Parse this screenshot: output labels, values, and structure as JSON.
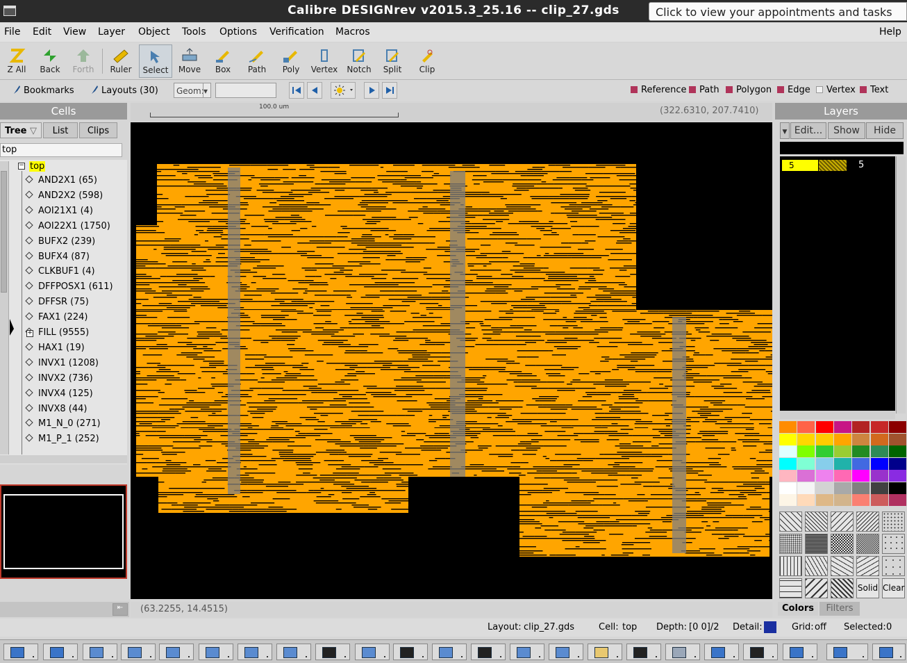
{
  "window": {
    "title": "Calibre DESIGNrev v2015.3_25.16  --  clip_27.gds"
  },
  "tooltip": "Click to view your appointments and tasks",
  "menu": {
    "items": [
      "File",
      "Edit",
      "View",
      "Layer",
      "Object",
      "Tools",
      "Options",
      "Verification",
      "Macros"
    ],
    "help": "Help"
  },
  "toolbar": {
    "z_all": "Z All",
    "back": "Back",
    "forth": "Forth",
    "ruler": "Ruler",
    "select": "Select",
    "move": "Move",
    "box": "Box",
    "path": "Path",
    "poly": "Poly",
    "vertex": "Vertex",
    "notch": "Notch",
    "split": "Split",
    "clip": "Clip"
  },
  "toolbar2": {
    "bookmarks": "Bookmarks",
    "layouts": "Layouts (30)",
    "geom": "Geom:",
    "geom_value": ""
  },
  "filters": [
    "Reference",
    "Path",
    "Polygon",
    "Edge",
    "Vertex",
    "Text"
  ],
  "cells": {
    "header": "Cells",
    "tabs": [
      "Tree",
      "List",
      "Clips"
    ],
    "filter_value": "top",
    "root": "top",
    "items": [
      "AND2X1  (65)",
      "AND2X2  (598)",
      "AOI21X1  (4)",
      "AOI22X1  (1750)",
      "BUFX2  (239)",
      "BUFX4  (87)",
      "CLKBUF1  (4)",
      "DFFPOSX1  (611)",
      "DFFSR  (75)",
      "FAX1  (224)",
      "FILL  (9555)",
      "HAX1  (19)",
      "INVX1  (1208)",
      "INVX2  (736)",
      "INVX4  (125)",
      "INVX8  (44)",
      "M1_N_0  (271)",
      "M1_P_1  (252)"
    ]
  },
  "canvas": {
    "scale_label": "100.0 um",
    "cursor_coords": "(322.6310, 207.7410)",
    "bottom_coords": "(63.2255, 14.4515)",
    "shape_color": "#ffa500",
    "fill_color": "#808080"
  },
  "layers": {
    "header": "Layers",
    "edit": "Edit...",
    "show": "Show",
    "hide": "Hide",
    "entry_name": "5",
    "entry_num": "5",
    "entry_color": "#ffff00"
  },
  "palette_tabs": {
    "colors": "Colors",
    "filters": "Filters"
  },
  "pattern_buttons": {
    "solid": "Solid",
    "clear": "Clear"
  },
  "status": {
    "layout_label": "Layout:",
    "layout": "clip_27.gds",
    "cell_label": "Cell:",
    "cell": "top",
    "depth_label": "Depth:",
    "depth": "[0 0]/2",
    "detail_label": "Detail:",
    "grid_label": "Grid:",
    "grid": "off",
    "selected_label": "Selected:",
    "selected": "0"
  }
}
